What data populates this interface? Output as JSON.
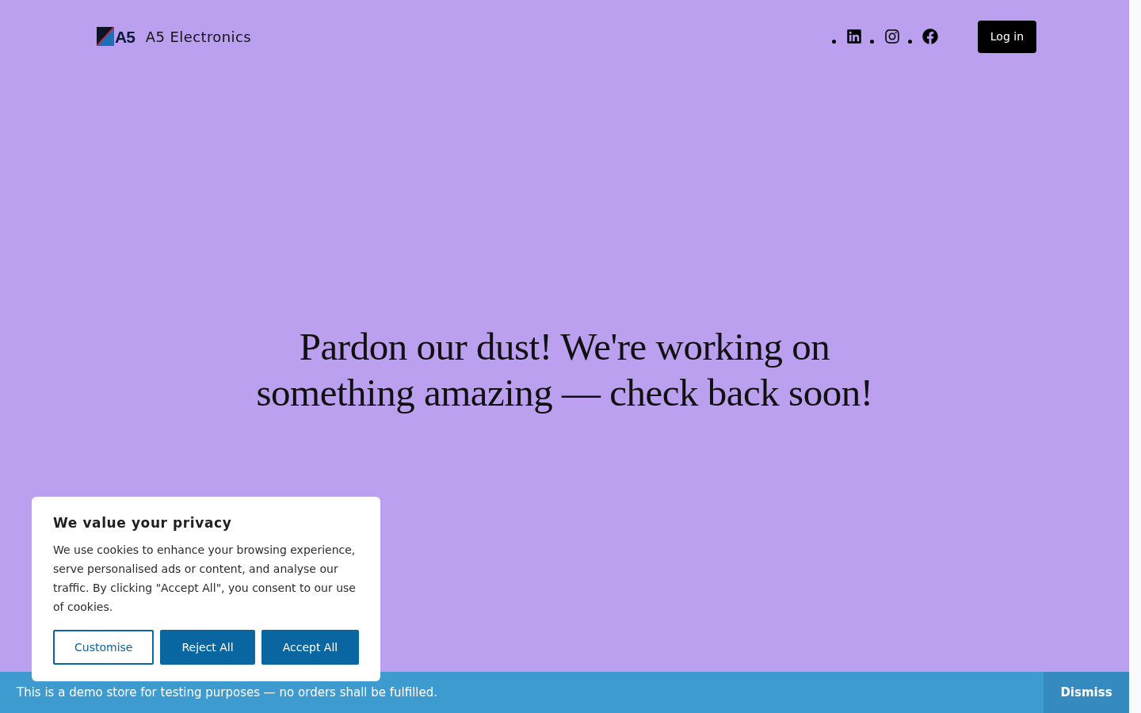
{
  "header": {
    "brand": {
      "logo_text": "A5",
      "name": "A5 Electronics"
    },
    "social_links": [
      {
        "kind": "linkedin"
      },
      {
        "kind": "instagram"
      },
      {
        "kind": "facebook"
      }
    ],
    "login_button": "Log in"
  },
  "hero": {
    "heading": "Pardon our dust! We're working on something amazing — check back soon!"
  },
  "cookie_banner": {
    "title": "We value your privacy",
    "text": "We use cookies to enhance your browsing experience, serve personalised ads or content, and analyse our traffic. By clicking \"Accept All\", you consent to our use of cookies.",
    "buttons": [
      {
        "label": "Customise",
        "kind": "outline"
      },
      {
        "label": "Reject All",
        "kind": "filled"
      },
      {
        "label": "Accept All",
        "kind": "filled"
      }
    ]
  },
  "notice_bar": {
    "text": "This is a demo store for testing purposes — no orders shall be fulfilled.",
    "dismiss": "Dismiss"
  }
}
